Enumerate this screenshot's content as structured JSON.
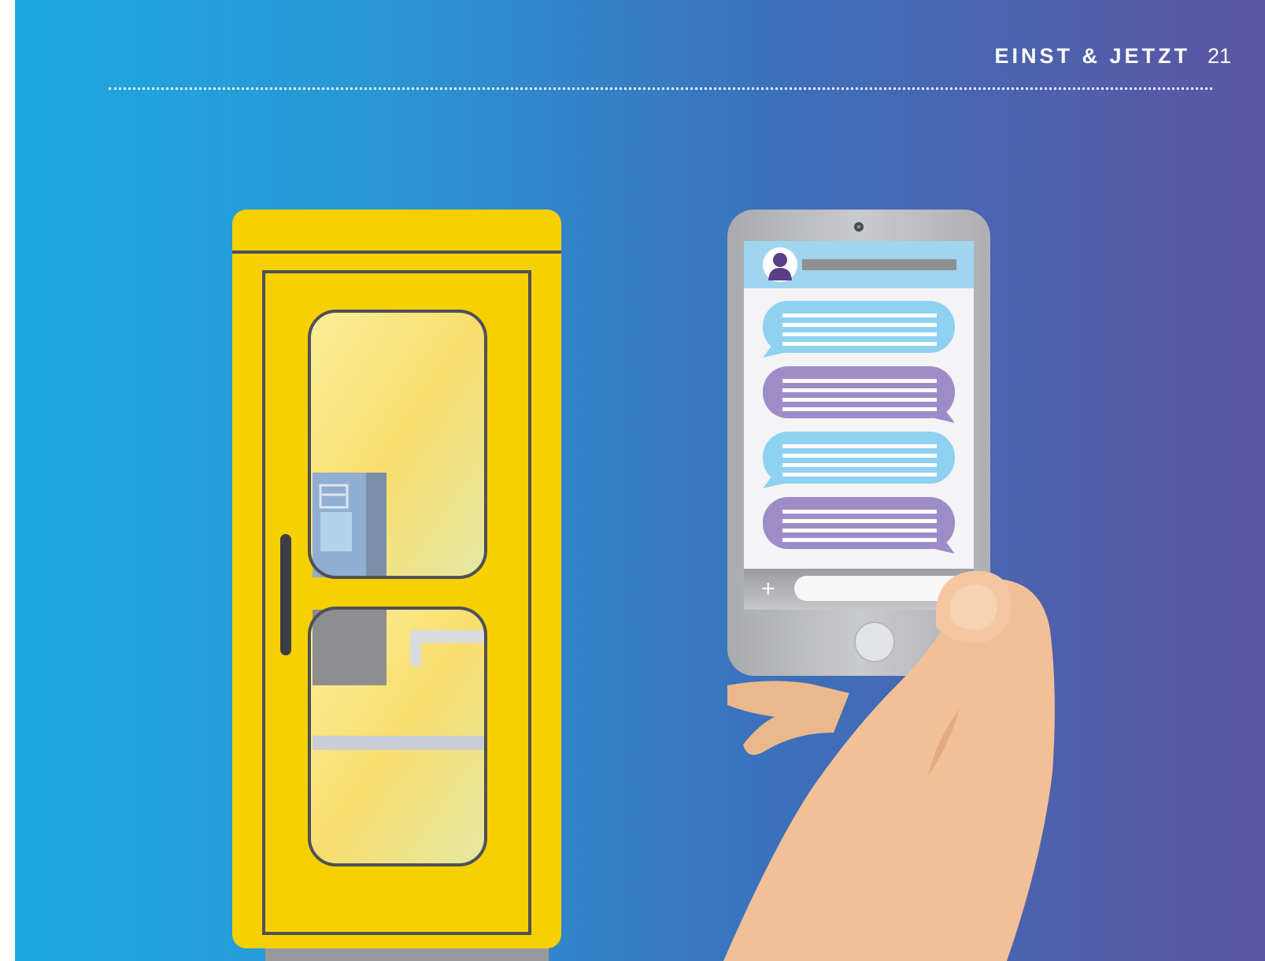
{
  "header": {
    "title": "EINST & JETZT",
    "page_number": "21"
  },
  "illustration": {
    "phone_booth": {
      "color": "#f7d000"
    },
    "smartphone": {
      "message_bubbles": [
        {
          "side": "incoming",
          "color": "#8ed1f0"
        },
        {
          "side": "outgoing",
          "color": "#9e8cc8"
        },
        {
          "side": "incoming",
          "color": "#8ed1f0"
        },
        {
          "side": "outgoing",
          "color": "#9e8cc8"
        }
      ],
      "plus_icon": "+"
    }
  },
  "colors": {
    "background_left": "#1ea9e1",
    "background_right": "#5c55a2",
    "booth_yellow": "#f7d000",
    "skin": "#f2c097"
  }
}
